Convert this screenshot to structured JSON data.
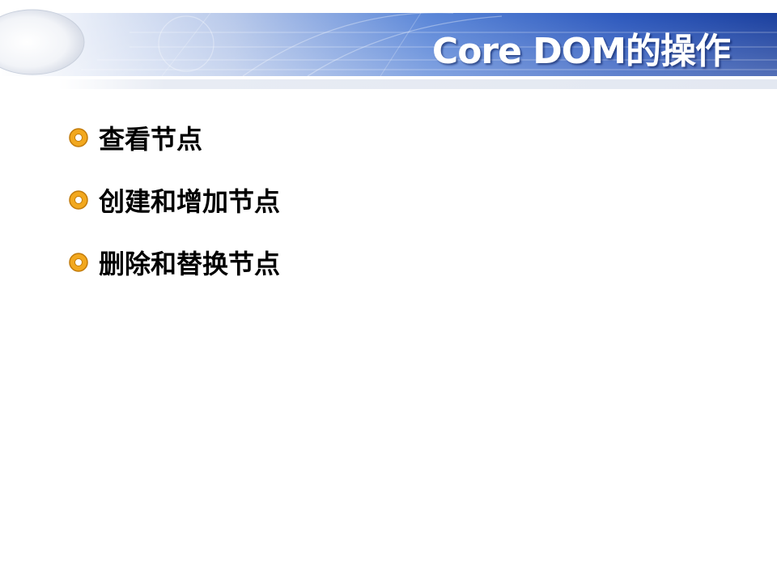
{
  "slide": {
    "title": "Core DOM的操作",
    "bullets": [
      {
        "text": "查看节点"
      },
      {
        "text": "创建和增加节点"
      },
      {
        "text": "删除和替换节点"
      }
    ]
  },
  "colors": {
    "header_blue_dark": "#1a3f9e",
    "header_blue_light": "#5a86d8",
    "title_text": "#ffffff",
    "bullet_orange": "#f2a81e",
    "body_text": "#000000"
  },
  "icons": {
    "bullet": "orange-ring-bullet-icon",
    "header_decoration": "globe-swoosh-icon"
  }
}
